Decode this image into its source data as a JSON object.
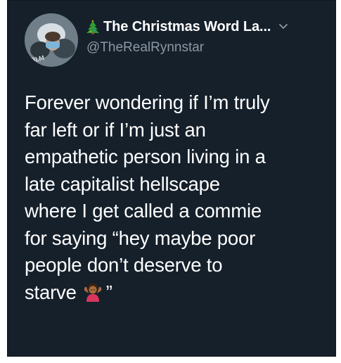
{
  "tweet": {
    "display_name": "The Christmas Word La...",
    "handle": "@TheRealRynnstar",
    "name_prefix_icon": "christmas-tree-icon",
    "menu_icon": "chevron-down-icon",
    "text_lines": [
      "Forever wondering if I’m truly",
      "far left or if I’m just an",
      "empathetic person living in a",
      "late capitalist hellscape",
      "where I get called a commie",
      "for saying “hey maybe poor",
      "people don’t deserve to",
      "starve"
    ],
    "closing_quote": "”",
    "emoji": "woman-shrugging-emoji"
  },
  "colors": {
    "background": "#15202b",
    "text": "#ffffff",
    "handle": "#8b98a5"
  }
}
